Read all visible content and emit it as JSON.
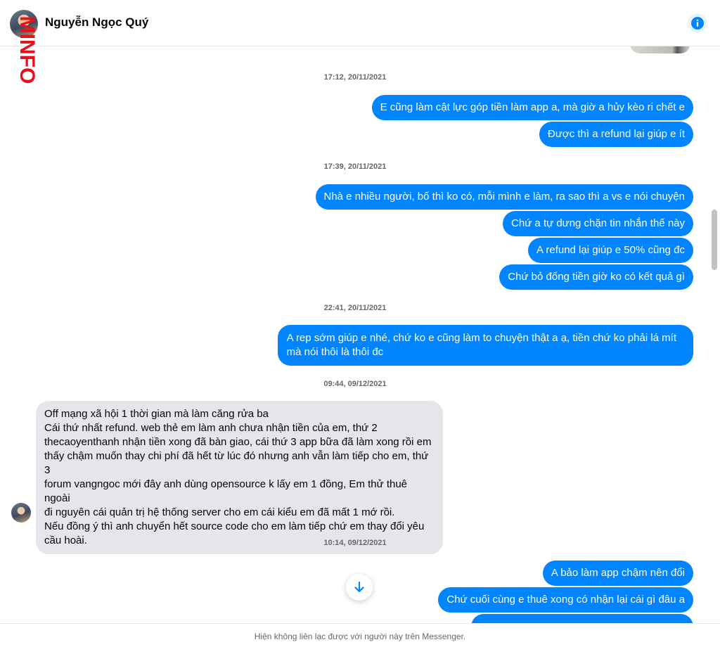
{
  "header": {
    "contact_name": "Nguyễn Ngọc Quý",
    "watermark": "MINFO",
    "info_icon": "info-icon"
  },
  "colors": {
    "outgoing_bubble": "#0084ff",
    "incoming_bubble": "#e4e6eb",
    "accent": "#0084ff",
    "watermark": "#e8101a"
  },
  "messages": {
    "ts1": "17:12, 20/11/2021",
    "m1": "E cũng làm cật lực góp tiền làm app a, mà giờ a hủy kèo ri chết e",
    "m2": "Được thì a refund lại giúp e ít",
    "ts2": "17:39, 20/11/2021",
    "m3": "Nhà e nhiều người, bố thì ko có, mỗi mình e làm, ra sao thì a vs e nói chuyện",
    "m4": "Chứ a tự dưng chặn tin nhắn thế này",
    "m5": "A refund lại giúp e 50% cũng đc",
    "m6": "Chứ bỏ đống tiền giờ ko có kết quả gì",
    "ts3": "22:41, 20/11/2021",
    "m7_line1": "A rep sớm giúp e nhé, chứ ko e cũng làm to chuyện thật a ạ, tiền chứ ko phải lá mít",
    "m7_line2": "mà nói thôi là thôi đc",
    "ts4": "09:44, 09/12/2021",
    "in_lines": [
      "Off mạng xã hội 1 thời gian mà làm căng rửa ba",
      "Cái thứ nhất refund. web thẻ em làm anh chưa nhận tiền của em, thứ 2",
      "thecaoyenthanh nhận tiền xong đã bàn giao, cái thứ 3 app bữa đã làm xong rồi em",
      "thấy chậm muốn thay chi phí đã hết từ lúc đó nhưng anh vẫn làm tiếp cho em, thứ 3",
      "forum vangngoc mới đây anh dùng opensource k lấy em 1 đồng, Em thử thuê ngoài",
      "đi nguyên cái quản trị hệ thống server cho em cái kiểu em đã mất 1 mớ rồi.",
      "Nếu đồng ý thì anh chuyển hết source code cho em làm tiếp chứ em thay đổi yêu",
      "cầu hoài."
    ],
    "ts5": "10:14, 09/12/2021",
    "m9": "A bảo làm app chậm nên đổi",
    "m10": "Chứ cuối cùng e thuê xong có nhận lại cái gì đâu a"
  },
  "footer": {
    "notice": "Hiện không liên lạc được với người này trên Messenger."
  }
}
